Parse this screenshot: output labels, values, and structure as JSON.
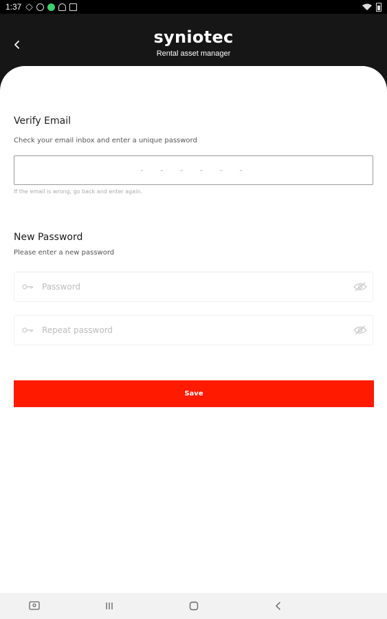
{
  "status_bar": {
    "time": "1:37",
    "icons": [
      "notification-icon",
      "at-icon",
      "sync-icon",
      "chat-icon",
      "clipboard-icon"
    ],
    "right_icons": [
      "wifi-icon",
      "battery-icon"
    ]
  },
  "header": {
    "brand": "syniotec",
    "subtitle": "Rental asset manager"
  },
  "verify": {
    "title": "Verify Email",
    "description": "Check your email inbox and enter a unique password",
    "code_placeholder": "- - - - - -",
    "helper": "If the email is wrong, go back and enter again."
  },
  "new_password": {
    "title": "New Password",
    "description": "Please enter a new password",
    "password_placeholder": "Password",
    "repeat_placeholder": "Repeat password"
  },
  "actions": {
    "save_label": "Save",
    "save_color": "#ff1a00"
  },
  "nav_bar": {
    "items": [
      "screenshot-icon",
      "recents-icon",
      "home-icon",
      "back-icon"
    ]
  }
}
